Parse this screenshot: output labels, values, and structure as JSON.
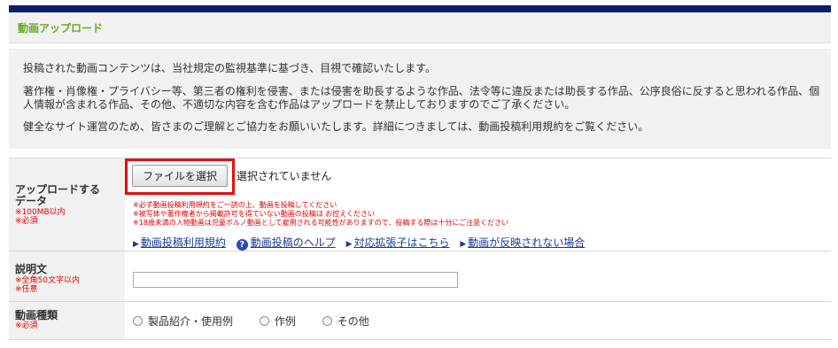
{
  "header": {
    "title": "動画アップロード"
  },
  "notice": {
    "p1": "投稿された動画コンテンツは、当社規定の監視基準に基づき、目視で確認いたします。",
    "p2": "著作権・肖像権・プライバシー等、第三者の権利を侵害、または侵害を助長するような作品、法令等に違反または助長する作品、公序良俗に反すると思われる作品、個人情報が含まれる作品、その他、不適切な内容を含む作品はアップロードを禁止しておりますのでご了承ください。",
    "p3": "健全なサイト運営のため、皆さまのご理解とご協力をお願いいたします。詳細につきましては、動画投稿利用規約をご覧ください。"
  },
  "upload": {
    "label_line1": "アップロードする",
    "label_line2": "データ",
    "note1": "※100MB以内",
    "note2": "※必須",
    "file_button": "ファイルを選択",
    "file_status": "選択されていません",
    "warnings": [
      "※必ず動画投稿利用規約をご一読の上、動画を投稿してください",
      "※被写体や著作権者から掲載許可を得ていない動画の投稿は お控えください",
      "※18歳未満の人物動画は児童ポルノ動画として雇用される可能性がありますので、投稿する際は十分にご注意ください"
    ],
    "links": {
      "terms": "動画投稿利用規約",
      "help": "動画投稿のヘルプ",
      "extensions": "対応拡張子はこちら",
      "not_reflected": "動画が反映されない場合"
    }
  },
  "description": {
    "label": "説明文",
    "note1": "※全角50文字以内",
    "note2": "※任意",
    "value": ""
  },
  "category": {
    "label": "動画種類",
    "note": "※必須",
    "options": [
      "製品紹介・使用例",
      "作例",
      "その他"
    ]
  },
  "colors": {
    "topbar": "#0b1f6b",
    "title": "#6aab24",
    "required": "#e00000",
    "link": "#1a3a9e",
    "highlight": "#e01010"
  }
}
